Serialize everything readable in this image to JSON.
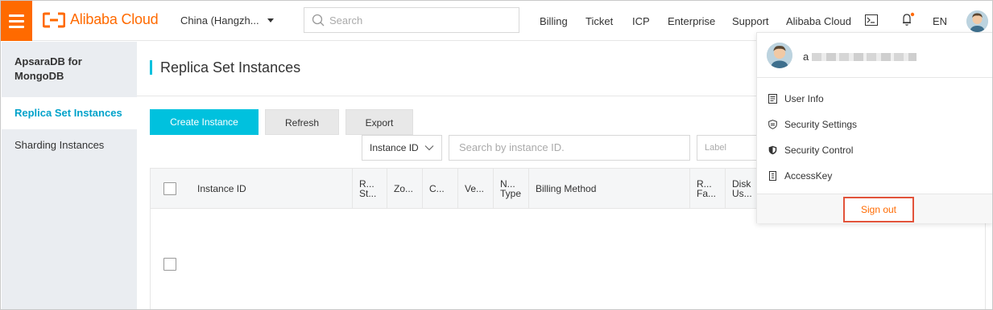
{
  "header": {
    "brand": "Alibaba Cloud",
    "region": "China (Hangzh...",
    "search_placeholder": "Search",
    "nav": [
      "Billing",
      "Ticket",
      "ICP",
      "Enterprise",
      "Support",
      "Alibaba Cloud"
    ],
    "language": "EN",
    "brand_color": "#ff6a00"
  },
  "sidebar": {
    "product": "ApsaraDB for MongoDB",
    "items": [
      {
        "label": "Replica Set Instances",
        "active": true
      },
      {
        "label": "Sharding Instances",
        "active": false
      }
    ]
  },
  "main": {
    "title": "Replica Set Instances",
    "buttons": {
      "create": "Create Instance",
      "refresh": "Refresh",
      "export": "Export"
    },
    "filter": {
      "field": "Instance ID",
      "search_placeholder": "Search by instance ID.",
      "label_placeholder": "Label"
    },
    "table": {
      "columns": [
        "Instance ID",
        "R... St...",
        "Zo...",
        "C...",
        "Ve...",
        "N... Type",
        "Billing Method",
        "R... Fa...",
        "Disk Us..."
      ]
    }
  },
  "user_menu": {
    "username_prefix": "a",
    "items": [
      {
        "label": "User Info",
        "icon": "document-icon"
      },
      {
        "label": "Security Settings",
        "icon": "shield-outline-icon"
      },
      {
        "label": "Security Control",
        "icon": "shield-filled-icon"
      },
      {
        "label": "AccessKey",
        "icon": "key-icon"
      }
    ],
    "sign_out": "Sign out"
  }
}
